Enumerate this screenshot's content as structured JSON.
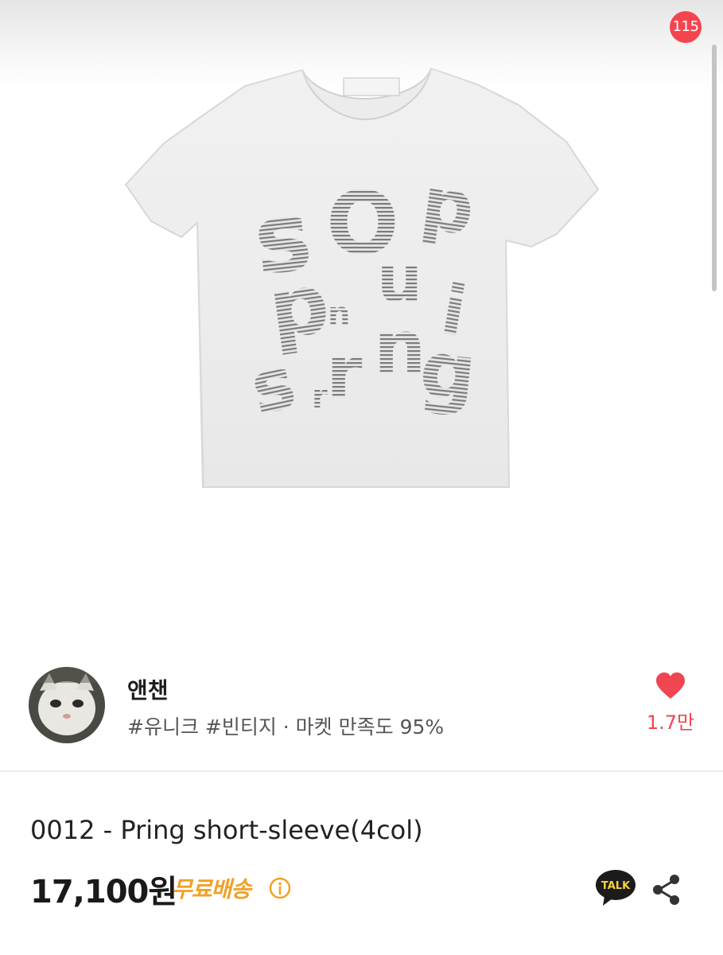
{
  "nav": {
    "back_icon": "chevron-left-icon",
    "home_icon": "home-icon",
    "search_icon": "search-icon",
    "cart_icon": "cart-icon",
    "cart_badge": "115"
  },
  "product_image": {
    "letters": [
      "s",
      "O",
      "u",
      "p",
      "p",
      "r",
      "n",
      "i",
      "s",
      "r",
      "n",
      "g"
    ]
  },
  "seller": {
    "name": "앤챈",
    "tags": "#유니크 #빈티지 · 마켓 만족도 95%",
    "likes": "1.7만"
  },
  "product": {
    "title": "0012 - Pring short-sleeve(4col)",
    "price": "17,100원",
    "shipping": "무료배송",
    "talk_label": "TALK"
  },
  "colors": {
    "accent_red": "#f4454f",
    "heart": "#f04652",
    "shipping": "#f2a027",
    "talk_bg": "#1b1b1b",
    "talk_text": "#f5d33a"
  }
}
